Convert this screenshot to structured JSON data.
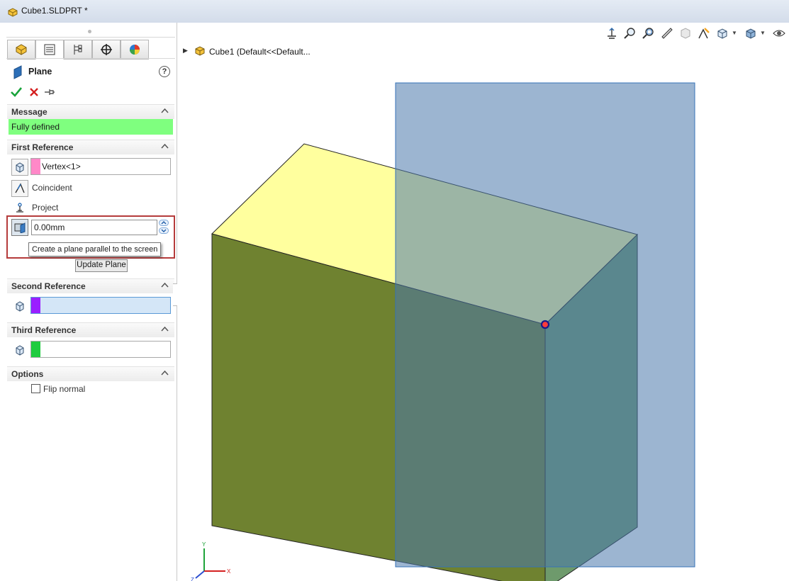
{
  "window": {
    "title": "Cube1.SLDPRT *"
  },
  "panel": {
    "tabs": [
      "featuremanager-icon",
      "propertymanager-icon",
      "configuration-icon",
      "dimxpert-icon",
      "display-manager-icon"
    ],
    "feature_title": "Plane",
    "help": "?",
    "message": {
      "header": "Message",
      "text": "Fully defined",
      "color": "#7fff7f"
    },
    "first_reference": {
      "header": "First Reference",
      "selection": "Vertex<1>",
      "swatch_color": "#ff88c8",
      "options": [
        "Coincident",
        "Project"
      ],
      "distance_value": "0.00mm",
      "tooltip": "Create a plane parallel to the screen",
      "update_button": "Update Plane"
    },
    "second_reference": {
      "header": "Second Reference",
      "selection": "",
      "swatch_color": "#9a1fff"
    },
    "third_reference": {
      "header": "Third Reference",
      "selection": "",
      "swatch_color": "#1fcc3f"
    },
    "options": {
      "header": "Options",
      "flip_normal": "Flip normal",
      "flip_normal_checked": false
    }
  },
  "viewport": {
    "tree_label": "Cube1  (Default<<Default...",
    "heads_up_icons": [
      "view-orientation-icon",
      "zoom-to-fit-icon",
      "zoom-area-icon",
      "previous-view-icon",
      "section-view-icon",
      "dynamic-annotation-icon",
      "view-setting-icon",
      "display-style-icon",
      "hide-show-icon"
    ],
    "triad": {
      "x": "X",
      "y": "Y",
      "z": "Z"
    },
    "colors": {
      "face_top": "#ffff9e",
      "face_front": "#6f8230",
      "face_side": "#6e9a6c",
      "plane": "#4a78ac",
      "vertex": "#ff3b3b"
    }
  }
}
